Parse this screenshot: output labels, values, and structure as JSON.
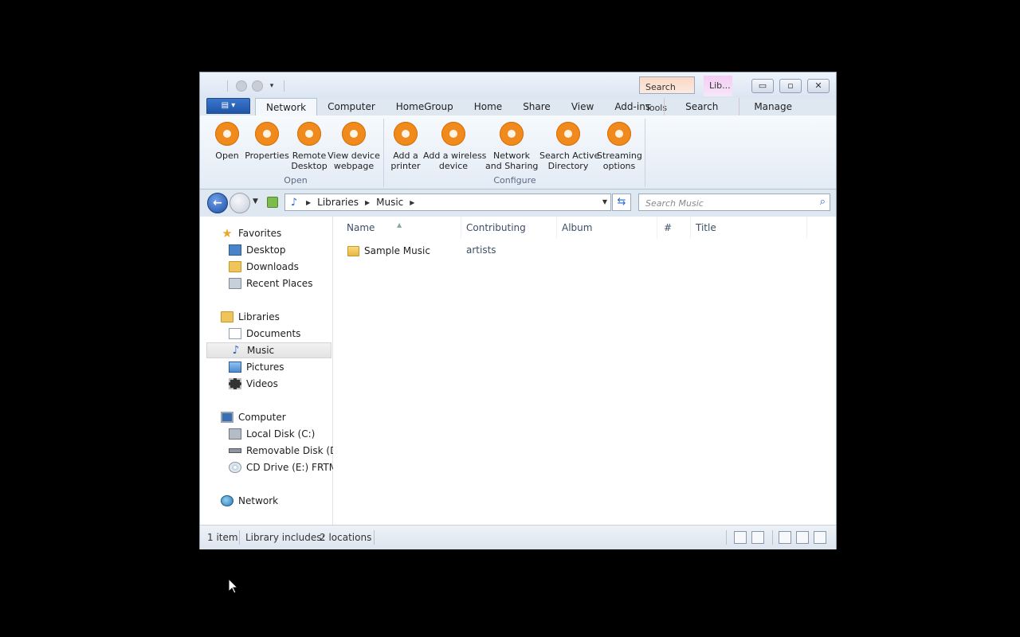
{
  "window": {
    "context_tabs": {
      "search_tools": "Search Tools",
      "library": "Lib..."
    },
    "file_button_label": "▤ ▾",
    "tabs": [
      "Network",
      "Computer",
      "HomeGroup",
      "Home",
      "Share",
      "View",
      "Add-ins",
      "Search",
      "Manage"
    ],
    "controls": {
      "minimize": "▭",
      "maximize": "▫",
      "close": "✕"
    }
  },
  "ribbon": {
    "open_group": {
      "label": "Open",
      "buttons": [
        "Open",
        "Properties",
        "Remote\nDesktop",
        "View device\nwebpage"
      ]
    },
    "configure_group": {
      "label": "Configure",
      "buttons": [
        "Add a\nprinter",
        "Add a wireless\ndevice",
        "Network\nand Sharing",
        "Search Active\nDirectory",
        "Streaming\noptions"
      ]
    },
    "accent_color": "#f08a1d"
  },
  "address": {
    "breadcrumbs": [
      "Libraries",
      "Music"
    ],
    "search_placeholder": "Search Music"
  },
  "nav_pane": {
    "favorites": {
      "label": "Favorites",
      "items": [
        "Desktop",
        "Downloads",
        "Recent Places"
      ]
    },
    "libraries": {
      "label": "Libraries",
      "items": [
        "Documents",
        "Music",
        "Pictures",
        "Videos"
      ],
      "selected": "Music"
    },
    "computer": {
      "label": "Computer",
      "items": [
        "Local Disk (C:)",
        "Removable Disk (D:)",
        "CD Drive (E:) FRTME"
      ]
    },
    "network": {
      "label": "Network"
    }
  },
  "content": {
    "columns": [
      "Name",
      "Contributing artists",
      "Album",
      "#",
      "Title"
    ],
    "files": [
      {
        "name": "Sample Music",
        "type": "folder"
      }
    ]
  },
  "status": {
    "item_count": "1 item",
    "library_label": "Library includes:",
    "library_value": "2 locations"
  }
}
